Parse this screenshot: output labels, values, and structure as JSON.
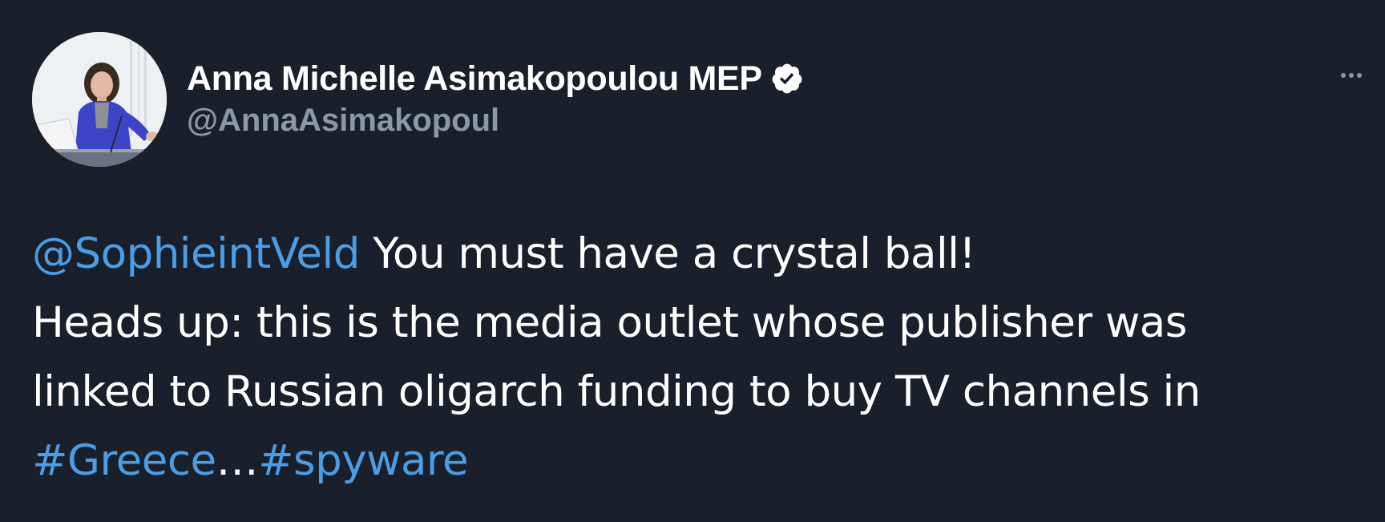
{
  "tweet": {
    "author": {
      "display_name": "Anna Michelle Asimakopoulou MEP",
      "handle": "@AnnaAsimakopoul",
      "verified": true,
      "avatar_icon": "profile-photo"
    },
    "more_icon": "ellipsis-horizontal-icon",
    "text": {
      "mention": "@SophieintVeld",
      "line1_rest": " You must have a crystal ball!",
      "line2": "Heads up: this is the media outlet whose publisher was",
      "line3": "linked to Russian oligarch funding to buy TV channels in",
      "hashtag1": "#Greece",
      "ellipsis": "…",
      "hashtag2": "#spyware"
    }
  },
  "colors": {
    "background": "#1a202b",
    "text": "#ffffff",
    "link": "#4a9de6",
    "secondary": "#8b98a5"
  }
}
